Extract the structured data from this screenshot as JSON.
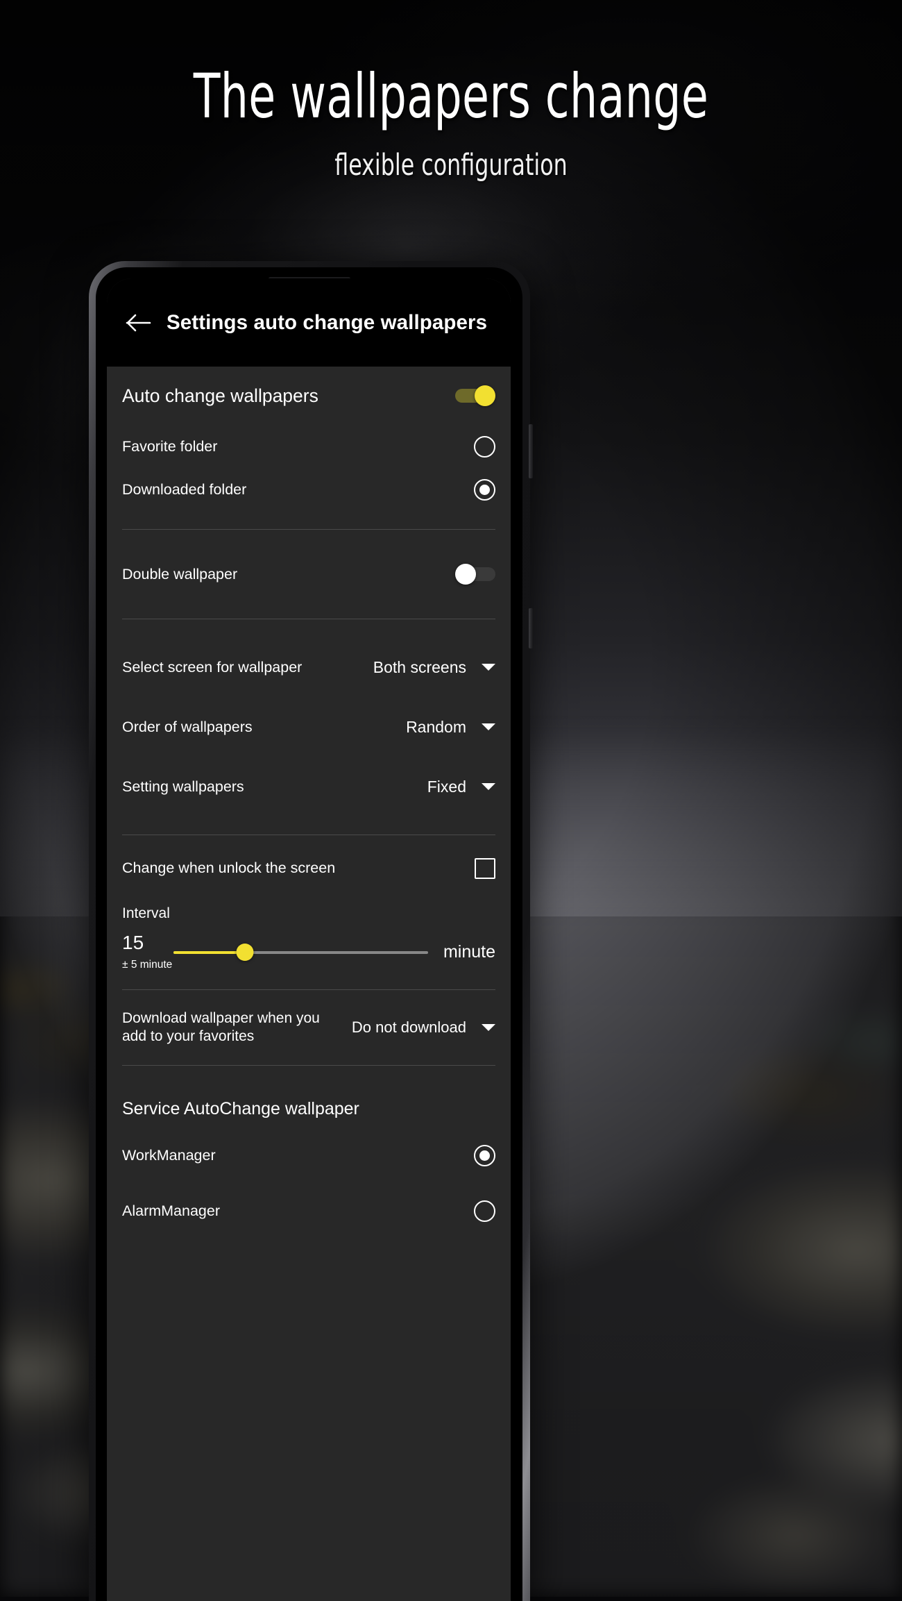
{
  "promo": {
    "title": "The wallpapers change",
    "subtitle": "flexible configuration"
  },
  "app": {
    "appbar": {
      "back_icon": "arrow-left-icon",
      "title": "Settings auto change wallpapers"
    },
    "auto_change": {
      "label": "Auto change wallpapers",
      "toggle_state": "on"
    },
    "folder_options": [
      {
        "label": "Favorite folder",
        "selected": false
      },
      {
        "label": "Downloaded folder",
        "selected": true
      }
    ],
    "double_wallpaper": {
      "label": "Double wallpaper",
      "toggle_state": "off"
    },
    "dropdowns": [
      {
        "label": "Select screen for wallpaper",
        "value": "Both screens",
        "icon": "chevron-down-icon"
      },
      {
        "label": "Order of wallpapers",
        "value": "Random",
        "icon": "chevron-down-icon"
      },
      {
        "label": "Setting wallpapers",
        "value": "Fixed",
        "icon": "chevron-down-icon"
      }
    ],
    "unlock_change": {
      "label": "Change when unlock the screen",
      "checked": false
    },
    "interval": {
      "title": "Interval",
      "value": "15",
      "tolerance": "± 5 minute",
      "unit": "minute",
      "percent": 28,
      "accent_color": "#f2e031"
    },
    "download_on_favorite": {
      "label": "Download wallpaper when you add to your favorites",
      "value": "Do not download",
      "icon": "chevron-down-icon"
    },
    "service_section": {
      "heading": "Service AutoChange wallpaper",
      "options": [
        {
          "label": "WorkManager",
          "selected": true
        },
        {
          "label": "AlarmManager",
          "selected": false
        }
      ]
    }
  },
  "colors": {
    "accent": "#f2e031",
    "panel": "#282828",
    "appbar": "#000000",
    "divider": "#4a4a4a",
    "text": "#ffffff"
  }
}
